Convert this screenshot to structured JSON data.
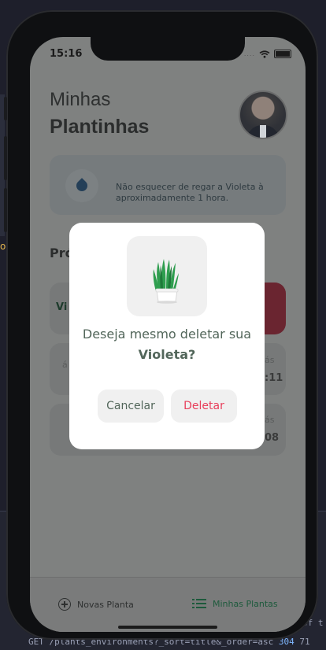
{
  "status": {
    "time": "15:16"
  },
  "header": {
    "greeting_line1": "Minhas",
    "greeting_line2": "Plantinhas"
  },
  "tip": {
    "text": "Não esquecer de regar a Violeta à aproximadamente 1 hora."
  },
  "section": {
    "title_visible": "Pró"
  },
  "cards": [
    {
      "name_visible": "Vi"
    },
    {
      "left_visible": "á",
      "right_top": "ás",
      "right_bottom": ":11"
    },
    {
      "right_top": "ás",
      "right_bottom": "08"
    }
  ],
  "modal": {
    "question": "Deseja mesmo deletar sua",
    "plant_name": "Violeta?",
    "cancel_label": "Cancelar",
    "delete_label": "Deletar"
  },
  "tabbar": {
    "new_plant_label": "Novas Planta",
    "my_plants_label": "Minhas Plantas"
  },
  "background": {
    "terminal_line": "GET /plants_environments?_sort=title&_order=asc",
    "status_code": "304",
    "trail": "71",
    "upper_text": "of t",
    "side_char": "o"
  },
  "colors": {
    "accent_green": "#32b768",
    "danger": "#e83f5b",
    "heading": "#52665a"
  }
}
